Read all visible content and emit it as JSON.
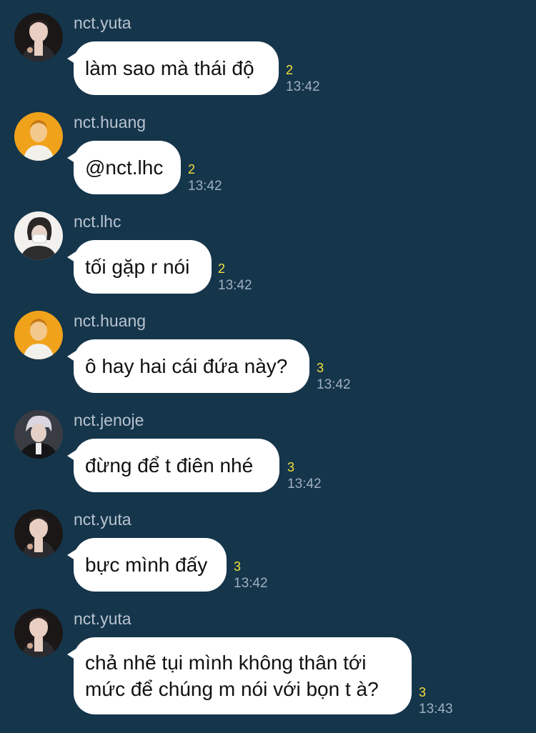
{
  "chat": {
    "messages": [
      {
        "sender": "nct.yuta",
        "text": "làm sao mà thái độ",
        "read_count": "2",
        "time": "13:42",
        "avatar_icon": "yuta-avatar"
      },
      {
        "sender": "nct.huang",
        "text": "@nct.lhc",
        "read_count": "2",
        "time": "13:42",
        "avatar_icon": "huang-avatar"
      },
      {
        "sender": "nct.lhc",
        "text": "tối gặp r nói",
        "read_count": "2",
        "time": "13:42",
        "avatar_icon": "lhc-avatar"
      },
      {
        "sender": "nct.huang",
        "text": "ô hay hai cái đứa này?",
        "read_count": "3",
        "time": "13:42",
        "avatar_icon": "huang-avatar"
      },
      {
        "sender": "nct.jenoje",
        "text": "đừng để t điên nhé",
        "read_count": "3",
        "time": "13:42",
        "avatar_icon": "jenoje-avatar"
      },
      {
        "sender": "nct.yuta",
        "text": "bực mình đấy",
        "read_count": "3",
        "time": "13:42",
        "avatar_icon": "yuta-avatar"
      },
      {
        "sender": "nct.yuta",
        "text": "chả nhẽ tụi mình không thân tới mức để chúng m nói với bọn t à?",
        "read_count": "3",
        "time": "13:43",
        "avatar_icon": "yuta-avatar"
      }
    ]
  },
  "colors": {
    "background": "#15354b",
    "bubble": "#ffffff",
    "read_count": "#f2e03a",
    "time": "#9fb0bf",
    "sender": "#b8c4cf"
  }
}
